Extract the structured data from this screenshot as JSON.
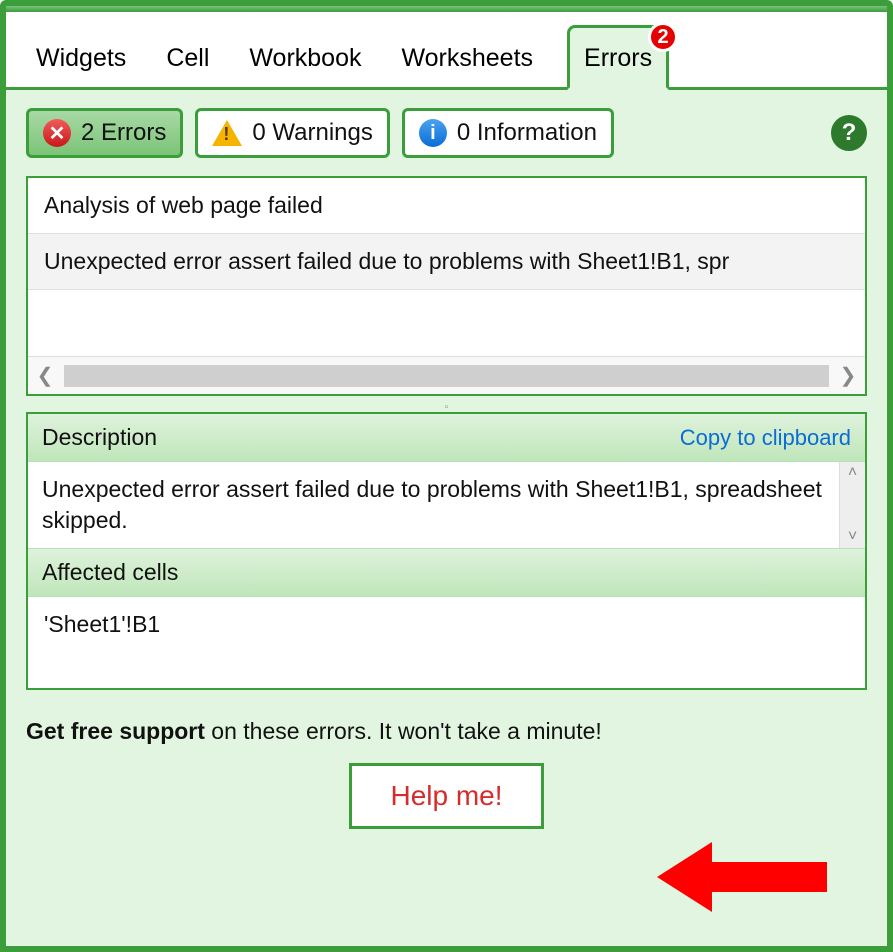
{
  "tabs": {
    "widgets": "Widgets",
    "cell": "Cell",
    "workbook": "Workbook",
    "worksheets": "Worksheets",
    "errors": "Errors",
    "errors_badge": "2"
  },
  "filters": {
    "errors_label": "2 Errors",
    "warnings_label": "0 Warnings",
    "info_label": "0 Information"
  },
  "error_list": {
    "group": "Analysis of web page failed",
    "item": "Unexpected error assert failed due to problems with Sheet1!B1, spr"
  },
  "description": {
    "header": "Description",
    "copy": "Copy to clipboard",
    "text": "Unexpected error assert failed due to problems with Sheet1!B1, spreadsheet skipped.",
    "affected_header": "Affected cells",
    "affected_cells": "'Sheet1'!B1"
  },
  "footer": {
    "bold": "Get free support",
    "rest": " on these errors. It won't take a minute!",
    "help_btn": "Help me!"
  }
}
